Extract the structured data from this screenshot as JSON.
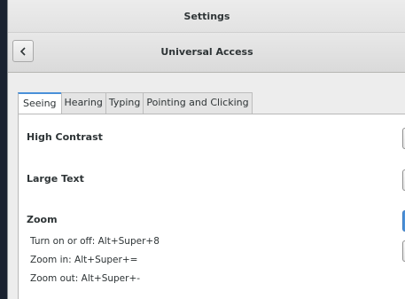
{
  "window": {
    "title": "Settings"
  },
  "header": {
    "title": "Universal Access"
  },
  "tabs": [
    {
      "label": "Seeing",
      "active": true
    },
    {
      "label": "Hearing",
      "active": false
    },
    {
      "label": "Typing",
      "active": false
    },
    {
      "label": "Pointing and Clicking",
      "active": false
    }
  ],
  "seeing": {
    "high_contrast": {
      "label": "High Contrast",
      "enabled": false
    },
    "large_text": {
      "label": "Large Text",
      "enabled": false
    },
    "zoom": {
      "label": "Zoom",
      "enabled": true,
      "shortcuts": [
        "Turn on or off:  Alt+Super+8",
        "Zoom in:  Alt+Super+=",
        "Zoom out:  Alt+Super+-"
      ]
    }
  },
  "colors": {
    "accent": "#4a90d9",
    "background": "#ededed",
    "desktop": "#1b2330"
  }
}
